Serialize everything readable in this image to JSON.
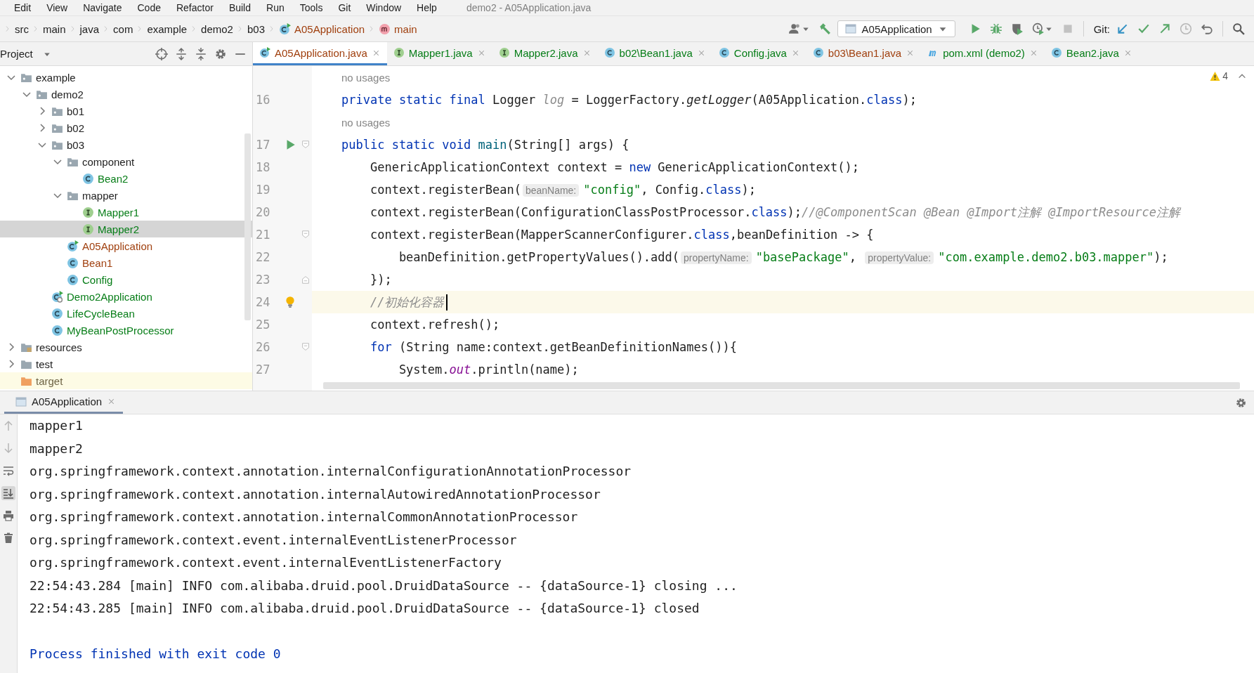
{
  "menu": {
    "items": [
      "Edit",
      "View",
      "Navigate",
      "Code",
      "Refactor",
      "Build",
      "Run",
      "Tools",
      "Git",
      "Window",
      "Help"
    ],
    "title": "demo2 - A05Application.java"
  },
  "breadcrumbs": [
    {
      "label": "src",
      "kind": "folder",
      "color": "#1e1e1e"
    },
    {
      "label": "main",
      "kind": "folder",
      "color": "#1e1e1e"
    },
    {
      "label": "java",
      "kind": "folder",
      "color": "#1e1e1e"
    },
    {
      "label": "com",
      "kind": "folder",
      "color": "#1e1e1e"
    },
    {
      "label": "example",
      "kind": "folder",
      "color": "#1e1e1e"
    },
    {
      "label": "demo2",
      "kind": "folder",
      "color": "#1e1e1e"
    },
    {
      "label": "b03",
      "kind": "folder",
      "color": "#1e1e1e"
    },
    {
      "label": "A05Application",
      "kind": "class",
      "color": "#a0400f"
    },
    {
      "label": "main",
      "kind": "method",
      "color": "#a0400f"
    }
  ],
  "toolbar": {
    "left_buttons": [
      {
        "kind": "users",
        "disabled": false
      },
      {
        "kind": "build",
        "disabled": false
      }
    ],
    "run_config": "A05Application",
    "run_buttons": [
      {
        "kind": "run",
        "disabled": false
      },
      {
        "kind": "debug",
        "disabled": false
      },
      {
        "kind": "coverage",
        "disabled": false
      },
      {
        "kind": "profile",
        "disabled": false
      },
      {
        "kind": "stop",
        "disabled": true
      }
    ],
    "git_label": "Git:",
    "git_buttons": [
      {
        "kind": "update",
        "disabled": false
      },
      {
        "kind": "commit",
        "disabled": false
      },
      {
        "kind": "push",
        "disabled": false
      },
      {
        "kind": "history",
        "disabled": true
      },
      {
        "kind": "rollback",
        "disabled": false
      }
    ],
    "end_buttons": [
      {
        "kind": "search",
        "disabled": false
      }
    ]
  },
  "project": {
    "title": "Project",
    "tree": [
      {
        "label": "example",
        "kind": "package",
        "color": "#1e1e1e",
        "expanded": true,
        "selected": false,
        "children": [
          {
            "label": "demo2",
            "kind": "package",
            "color": "#1e1e1e",
            "expanded": true,
            "selected": false,
            "children": [
              {
                "label": "b01",
                "kind": "package",
                "color": "#1e1e1e",
                "expanded": false,
                "selected": false
              },
              {
                "label": "b02",
                "kind": "package",
                "color": "#1e1e1e",
                "expanded": false,
                "selected": false
              },
              {
                "label": "b03",
                "kind": "package",
                "color": "#1e1e1e",
                "expanded": true,
                "selected": false,
                "children": [
                  {
                    "label": "component",
                    "kind": "package",
                    "color": "#1e1e1e",
                    "expanded": true,
                    "selected": false,
                    "children": [
                      {
                        "label": "Bean2",
                        "kind": "class",
                        "color": "#067d17",
                        "selected": false
                      }
                    ]
                  },
                  {
                    "label": "mapper",
                    "kind": "package",
                    "color": "#1e1e1e",
                    "expanded": true,
                    "selected": false,
                    "children": [
                      {
                        "label": "Mapper1",
                        "kind": "interface",
                        "color": "#067d17",
                        "selected": false
                      },
                      {
                        "label": "Mapper2",
                        "kind": "interface",
                        "color": "#067d17",
                        "selected": true
                      }
                    ]
                  },
                  {
                    "label": "A05Application",
                    "kind": "app",
                    "color": "#a0400f",
                    "selected": false
                  },
                  {
                    "label": "Bean1",
                    "kind": "class",
                    "color": "#a0400f",
                    "selected": false
                  },
                  {
                    "label": "Config",
                    "kind": "class",
                    "color": "#067d17",
                    "selected": false
                  }
                ]
              },
              {
                "label": "Demo2Application",
                "kind": "spring-app",
                "color": "#067d17",
                "selected": false
              },
              {
                "label": "LifeCycleBean",
                "kind": "class",
                "color": "#067d17",
                "selected": false
              },
              {
                "label": "MyBeanPostProcessor",
                "kind": "class",
                "color": "#067d17",
                "selected": false
              }
            ]
          }
        ]
      },
      {
        "label": "resources",
        "kind": "resources",
        "color": "#1e1e1e",
        "expanded": false,
        "selected": false
      },
      {
        "label": "test",
        "kind": "folder",
        "color": "#1e1e1e",
        "expanded": false,
        "selected": false
      },
      {
        "label": "target",
        "kind": "excluded",
        "color": "#6e6446",
        "selected": false
      }
    ]
  },
  "tabs": [
    {
      "label": "A05Application.java",
      "kind": "app",
      "color": "#a0400f",
      "selected": true
    },
    {
      "label": "Mapper1.java",
      "kind": "interface",
      "color": "#067d17",
      "selected": false
    },
    {
      "label": "Mapper2.java",
      "kind": "interface",
      "color": "#067d17",
      "selected": false
    },
    {
      "label": "b02\\Bean1.java",
      "kind": "class",
      "color": "#067d17",
      "selected": false
    },
    {
      "label": "Config.java",
      "kind": "class",
      "color": "#067d17",
      "selected": false
    },
    {
      "label": "b03\\Bean1.java",
      "kind": "class",
      "color": "#a0400f",
      "selected": false
    },
    {
      "label": "pom.xml (demo2)",
      "kind": "maven",
      "color": "#067d17",
      "selected": false
    },
    {
      "label": "Bean2.java",
      "kind": "class",
      "color": "#067d17",
      "selected": false
    }
  ],
  "editor": {
    "warnings": "4",
    "lines": [
      {
        "kind": "inlay",
        "text": "no usages"
      },
      {
        "kind": "code",
        "number": "16",
        "current": false,
        "segments": [
          {
            "kind": "keyword",
            "text": "private static final "
          },
          {
            "kind": "plain",
            "text": "Logger "
          },
          {
            "kind": "unused",
            "text": "log"
          },
          {
            "kind": "plain",
            "text": " = LoggerFactory."
          },
          {
            "kind": "static",
            "text": "getLogger"
          },
          {
            "kind": "plain",
            "text": "(A05Application."
          },
          {
            "kind": "keyword",
            "text": "class"
          },
          {
            "kind": "plain",
            "text": ");"
          }
        ]
      },
      {
        "kind": "inlay",
        "text": "no usages"
      },
      {
        "kind": "code",
        "number": "17",
        "current": false,
        "gutter": [
          {
            "kind": "run"
          },
          {
            "kind": "fold-start"
          }
        ],
        "segments": [
          {
            "kind": "keyword",
            "text": "public static void "
          },
          {
            "kind": "declaration",
            "text": "main"
          },
          {
            "kind": "plain",
            "text": "(String[] args) {"
          }
        ]
      },
      {
        "kind": "code",
        "number": "18",
        "current": false,
        "segments": [
          {
            "kind": "plain",
            "text": "    GenericApplicationContext context = "
          },
          {
            "kind": "keyword",
            "text": "new"
          },
          {
            "kind": "plain",
            "text": " GenericApplicationContext();"
          }
        ]
      },
      {
        "kind": "code",
        "number": "19",
        "current": false,
        "segments": [
          {
            "kind": "plain",
            "text": "    context.registerBean("
          },
          {
            "kind": "hint",
            "text": "beanName:"
          },
          {
            "kind": "string",
            "text": "\"config\""
          },
          {
            "kind": "plain",
            "text": ", Config."
          },
          {
            "kind": "keyword",
            "text": "class"
          },
          {
            "kind": "plain",
            "text": ");"
          }
        ]
      },
      {
        "kind": "code",
        "number": "20",
        "current": false,
        "segments": [
          {
            "kind": "plain",
            "text": "    context.registerBean(ConfigurationClassPostProcessor."
          },
          {
            "kind": "keyword",
            "text": "class"
          },
          {
            "kind": "plain",
            "text": ");"
          },
          {
            "kind": "comment",
            "text": "//@ComponentScan @Bean @Import注解 @ImportResource注解"
          }
        ]
      },
      {
        "kind": "code",
        "number": "21",
        "current": false,
        "gutter": [
          {
            "kind": "fold-start"
          }
        ],
        "segments": [
          {
            "kind": "plain",
            "text": "    context.registerBean(MapperScannerConfigurer."
          },
          {
            "kind": "keyword",
            "text": "class"
          },
          {
            "kind": "plain",
            "text": ",beanDefinition -> {"
          }
        ]
      },
      {
        "kind": "code",
        "number": "22",
        "current": false,
        "segments": [
          {
            "kind": "plain",
            "text": "        beanDefinition.getPropertyValues().add("
          },
          {
            "kind": "hint",
            "text": "propertyName:"
          },
          {
            "kind": "string",
            "text": "\"basePackage\""
          },
          {
            "kind": "plain",
            "text": ", "
          },
          {
            "kind": "hint",
            "text": "propertyValue:"
          },
          {
            "kind": "string",
            "text": "\"com.example.demo2.b03.mapper\""
          },
          {
            "kind": "plain",
            "text": ");"
          }
        ]
      },
      {
        "kind": "code",
        "number": "23",
        "current": false,
        "gutter": [
          {
            "kind": "fold-end"
          }
        ],
        "segments": [
          {
            "kind": "plain",
            "text": "    });"
          }
        ]
      },
      {
        "kind": "code",
        "number": "24",
        "current": true,
        "gutter": [
          {
            "kind": "bulb"
          }
        ],
        "segments": [
          {
            "kind": "comment",
            "text": "    //初始化容器"
          }
        ]
      },
      {
        "kind": "code",
        "number": "25",
        "current": false,
        "segments": [
          {
            "kind": "plain",
            "text": "    context.refresh();"
          }
        ]
      },
      {
        "kind": "code",
        "number": "26",
        "current": false,
        "gutter": [
          {
            "kind": "fold-start"
          }
        ],
        "segments": [
          {
            "kind": "keyword",
            "text": "    for"
          },
          {
            "kind": "plain",
            "text": " (String name:context.getBeanDefinitionNames()){"
          }
        ]
      },
      {
        "kind": "code",
        "number": "27",
        "current": false,
        "segments": [
          {
            "kind": "plain",
            "text": "        System."
          },
          {
            "kind": "field",
            "text": "out"
          },
          {
            "kind": "plain",
            "text": ".println(name);"
          }
        ]
      }
    ]
  },
  "console": {
    "tab": "A05Application",
    "buttons": [
      {
        "kind": "up",
        "disabled": true,
        "selected": false
      },
      {
        "kind": "down",
        "disabled": true,
        "selected": false
      },
      {
        "kind": "wrap",
        "disabled": false,
        "selected": false
      },
      {
        "kind": "scroll-end",
        "disabled": false,
        "selected": true
      },
      {
        "kind": "print",
        "disabled": false,
        "selected": false
      },
      {
        "kind": "trash",
        "disabled": false,
        "selected": false
      }
    ],
    "lines": [
      {
        "kind": "stdout",
        "text": "mapper1"
      },
      {
        "kind": "stdout",
        "text": "mapper2"
      },
      {
        "kind": "stdout",
        "text": "org.springframework.context.annotation.internalConfigurationAnnotationProcessor"
      },
      {
        "kind": "stdout",
        "text": "org.springframework.context.annotation.internalAutowiredAnnotationProcessor"
      },
      {
        "kind": "stdout",
        "text": "org.springframework.context.annotation.internalCommonAnnotationProcessor"
      },
      {
        "kind": "stdout",
        "text": "org.springframework.context.event.internalEventListenerProcessor"
      },
      {
        "kind": "stdout",
        "text": "org.springframework.context.event.internalEventListenerFactory"
      },
      {
        "kind": "stdout",
        "text": "22:54:43.284 [main] INFO com.alibaba.druid.pool.DruidDataSource -- {dataSource-1} closing ..."
      },
      {
        "kind": "stdout",
        "text": "22:54:43.285 [main] INFO com.alibaba.druid.pool.DruidDataSource -- {dataSource-1} closed"
      },
      {
        "kind": "exit",
        "text": "Process finished with exit code 0"
      }
    ]
  }
}
